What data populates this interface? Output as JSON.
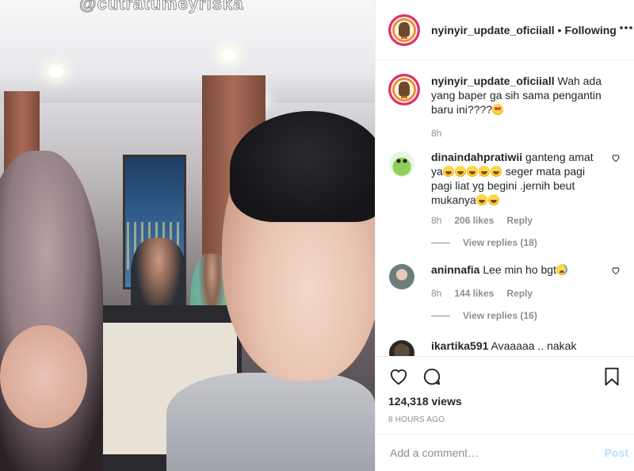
{
  "media": {
    "watermark": "@cutratumeyriska"
  },
  "header": {
    "username": "nyinyir_update_oficiiall",
    "separator": "•",
    "follow_label": "Following",
    "more_icon": "more-horizontal-icon"
  },
  "caption": {
    "username": "nyinyir_update_oficiiall",
    "text": "Wah ada yang baper ga sih sama pengantin baru ini????",
    "time": "8h"
  },
  "comments": [
    {
      "username": "dinaindahpratiwii",
      "text_a": "ganteng amat ya",
      "text_b": "seger mata pagi pagi liat yg begini .jernih beut mukanya",
      "time": "8h",
      "likes": "206 likes",
      "reply": "Reply",
      "view_replies": "View replies (18)"
    },
    {
      "username": "aninnafia",
      "text": "Lee min ho bgt",
      "time": "8h",
      "likes": "144 likes",
      "reply": "Reply",
      "view_replies": "View replies (16)"
    },
    {
      "username": "ikartika591",
      "text": "Avaaaaa .. nakak"
    }
  ],
  "actions": {
    "views": "124,318 views",
    "time_ago": "8 HOURS AGO"
  },
  "add_comment": {
    "placeholder": "Add a comment…",
    "post_label": "Post"
  },
  "colors": {
    "text": "#262626",
    "muted": "#8e8e8e",
    "border": "#efefef",
    "post_disabled": "#b2dffc"
  }
}
